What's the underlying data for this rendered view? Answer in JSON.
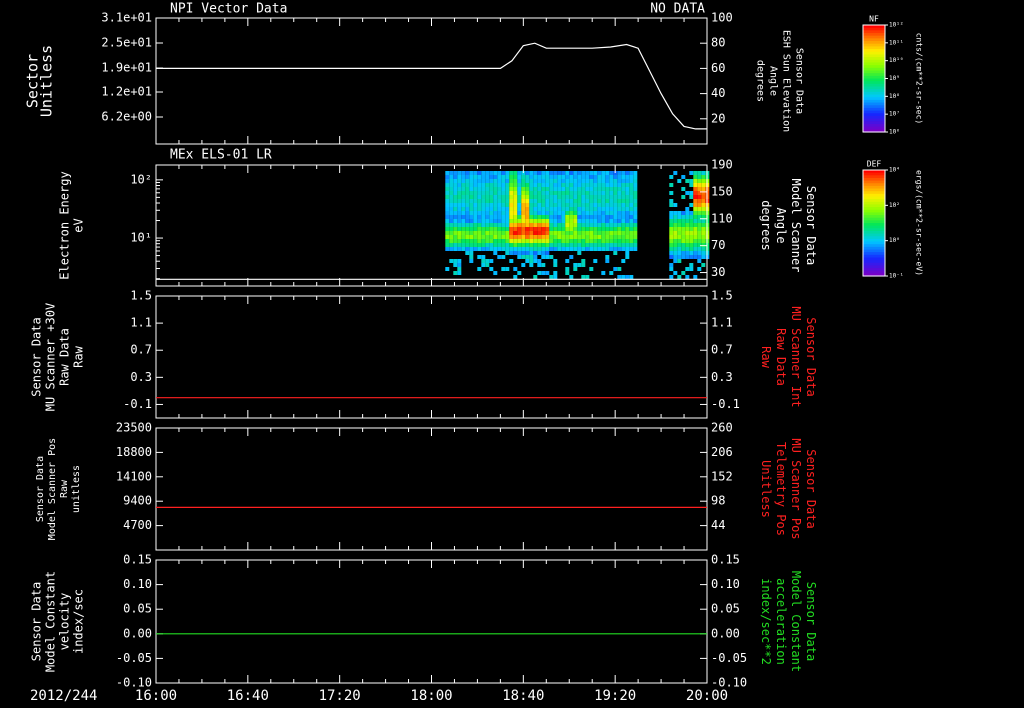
{
  "colors": {
    "background": "#000000",
    "foreground": "#ffffff",
    "red": "#ff2020",
    "green": "#22dd22"
  },
  "footer": {
    "date_label": "2012/244"
  },
  "x_axis": {
    "range": [
      "16:00",
      "20:00"
    ],
    "tick_labels": [
      "16:00",
      "16:40",
      "17:20",
      "18:00",
      "18:40",
      "19:20",
      "20:00"
    ],
    "tick_minutes": [
      0,
      40,
      80,
      120,
      160,
      200,
      240
    ]
  },
  "colorbars": [
    {
      "tag": "NF",
      "unit": "cnts/(cm**2-sr-sec)",
      "tick_labels": [
        "10¹²",
        "10¹¹",
        "10¹⁰",
        "10⁹",
        "10⁸",
        "10⁷",
        "10⁶"
      ],
      "colormap": "rainbow"
    },
    {
      "tag": "DEF",
      "unit": "ergs/(cm**2-sr-sec-eV)",
      "tick_labels": [
        "10⁴",
        "10²",
        "10⁰",
        "10⁻¹"
      ],
      "colormap": "rainbow"
    }
  ],
  "chart_data": [
    {
      "type": "line",
      "title": "NPI Vector Data",
      "status": "NO DATA",
      "left_axis": {
        "label_lines": [
          "Sector",
          "Unitless"
        ],
        "tick_labels": [
          "3.1e+01",
          "2.5e+01",
          "1.9e+01",
          "1.2e+01",
          "6.2e+00"
        ]
      },
      "right_axis": {
        "label_lines": [
          "Sensor Data",
          "ESH Sun Elevation",
          "Angle",
          "degrees"
        ],
        "ylim": [
          0,
          100
        ],
        "ticks": [
          100,
          80,
          60,
          40,
          20
        ]
      },
      "series": [
        {
          "color": "#ffffff",
          "x_minutes": [
            0,
            20,
            60,
            100,
            150,
            155,
            160,
            165,
            170,
            180,
            190,
            198,
            205,
            210,
            215,
            220,
            225,
            230,
            235,
            240
          ],
          "y": [
            60,
            60,
            60,
            60,
            60,
            66,
            78,
            80,
            76,
            76,
            76,
            77,
            79,
            76,
            58,
            40,
            24,
            14,
            12,
            12
          ]
        }
      ]
    },
    {
      "type": "heatmap",
      "title": "MEx ELS-01 LR",
      "left_axis": {
        "label_lines": [
          "Electron Energy",
          "eV"
        ],
        "scale": "log",
        "ylim": [
          1.5,
          180
        ],
        "ticks": [
          100,
          10
        ],
        "tick_labels": [
          "10²",
          "10¹"
        ]
      },
      "right_axis": {
        "label_lines": [
          "Sensor Data",
          "Model Scanner",
          "Angle",
          "degrees"
        ],
        "ylim": [
          10,
          190
        ],
        "ticks": [
          190,
          150,
          110,
          70,
          30
        ]
      },
      "data_start_minutes": 126,
      "series": [
        {
          "color": "#ffffff",
          "x_minutes": [
            0,
            240
          ],
          "y": [
            20,
            20
          ]
        }
      ]
    },
    {
      "type": "line",
      "left_axis": {
        "label_lines": [
          "Sensor Data",
          "MU Scanner +30V",
          "Raw Data",
          "Raw"
        ],
        "ylim": [
          -0.3,
          1.5
        ],
        "ticks": [
          1.5,
          1.1,
          0.7,
          0.3,
          -0.1
        ],
        "tick_labels": [
          "1.5",
          "1.1",
          "0.7",
          "0.3",
          "-0.1"
        ]
      },
      "right_axis": {
        "label_lines": [
          "Sensor Data",
          "MU Scanner Int",
          "Raw Data",
          "Raw"
        ],
        "ylim": [
          -0.3,
          1.5
        ],
        "ticks": [
          1.5,
          1.1,
          0.7,
          0.3,
          -0.1
        ],
        "tick_labels": [
          "1.5",
          "1.1",
          "0.7",
          "0.3",
          "-0.1"
        ]
      },
      "series": [
        {
          "color": "#ff2020",
          "x_minutes": [
            0,
            240
          ],
          "y": [
            0.0,
            0.0
          ]
        }
      ]
    },
    {
      "type": "line",
      "left_axis": {
        "label_lines": [
          "Sensor Data",
          "Model Scanner Pos",
          "Raw",
          "unitless"
        ],
        "ylim": [
          0,
          23500
        ],
        "ticks": [
          23500,
          18800,
          14100,
          9400,
          4700
        ],
        "tick_labels": [
          "23500",
          "18800",
          "14100",
          "9400",
          "4700"
        ]
      },
      "right_axis": {
        "label_lines": [
          "Sensor Data",
          "MU Scanner Pos",
          "Telemetry Pos",
          "Unitless"
        ],
        "ylim": [
          -10,
          260
        ],
        "ticks": [
          260,
          206,
          152,
          98,
          44
        ],
        "tick_labels": [
          "260",
          "206",
          "152",
          "98",
          "44"
        ]
      },
      "series": [
        {
          "color": "#ff2020",
          "x_minutes": [
            0,
            240
          ],
          "y": [
            8200,
            8200
          ]
        }
      ]
    },
    {
      "type": "line",
      "left_axis": {
        "label_lines": [
          "Sensor Data",
          "Model Constant",
          "velocity",
          "index/sec"
        ],
        "ylim": [
          -0.1,
          0.15
        ],
        "ticks": [
          0.15,
          0.1,
          0.05,
          0.0,
          -0.05,
          -0.1
        ],
        "tick_labels": [
          "0.15",
          "0.10",
          "0.05",
          "0.00",
          "-0.05",
          "-0.10"
        ]
      },
      "right_axis": {
        "label_lines": [
          "Sensor Data",
          "Model Constant",
          "acceleration",
          "index/sec**2"
        ],
        "ylim": [
          -0.1,
          0.15
        ],
        "ticks": [
          0.15,
          0.1,
          0.05,
          0.0,
          -0.05,
          -0.1
        ],
        "tick_labels": [
          "0.15",
          "0.10",
          "0.05",
          "0.00",
          "-0.05",
          "-0.10"
        ]
      },
      "series": [
        {
          "color": "#22dd22",
          "x_minutes": [
            0,
            240
          ],
          "y": [
            0.0,
            0.0
          ]
        }
      ]
    }
  ]
}
